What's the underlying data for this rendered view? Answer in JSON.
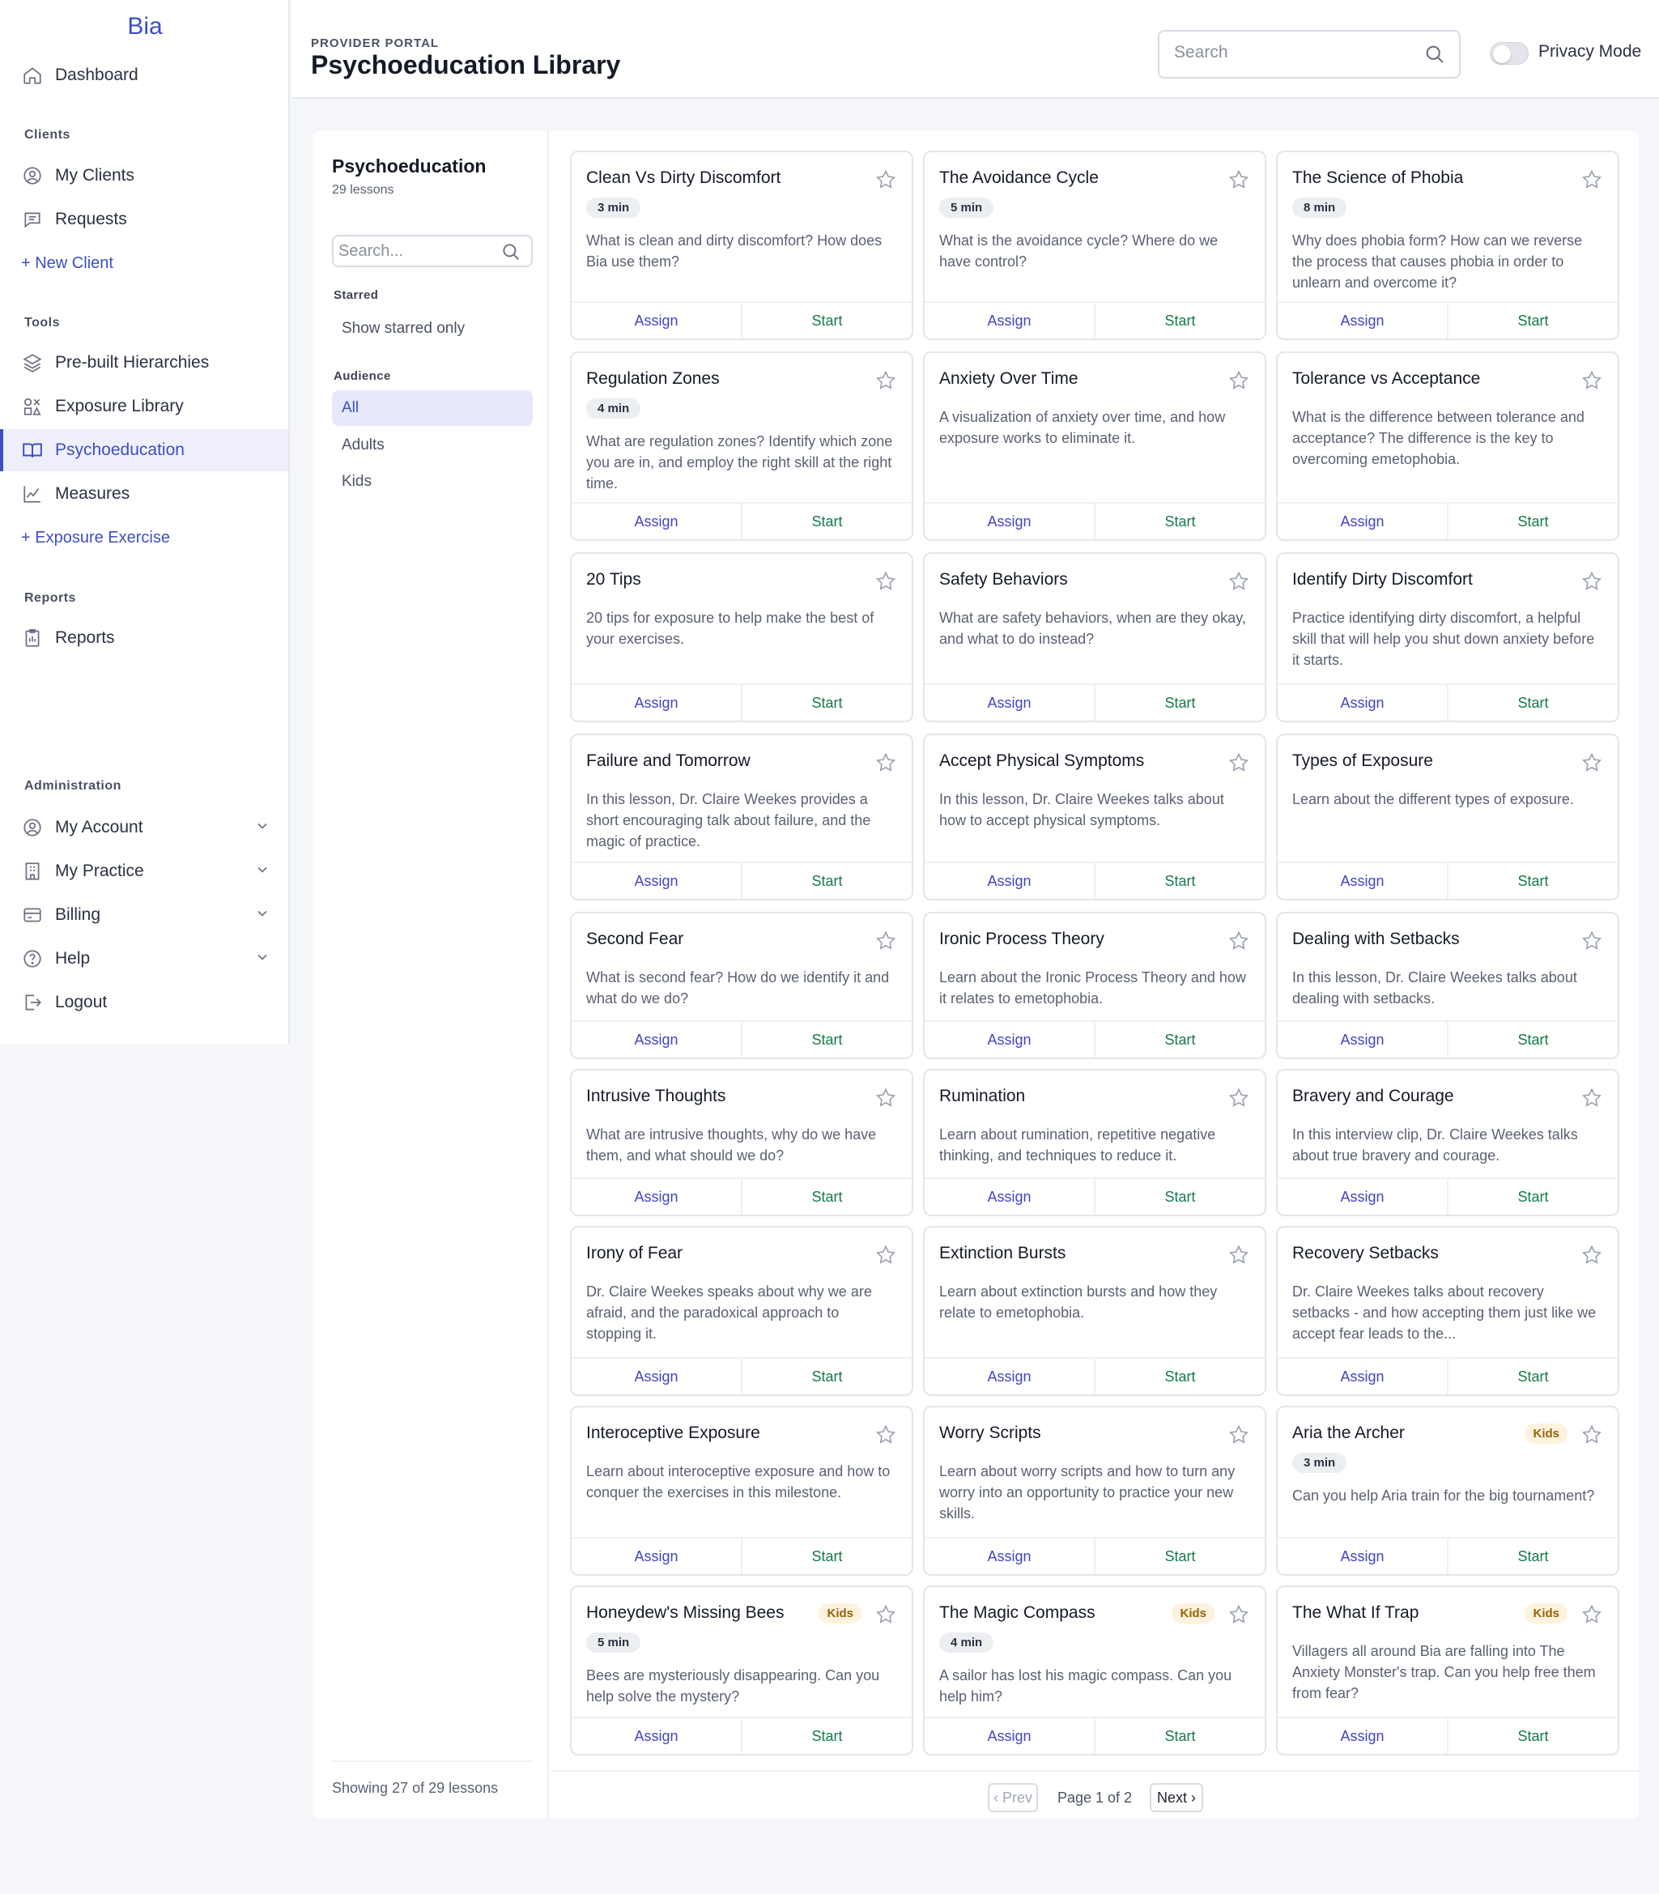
{
  "app": {
    "brand": "Bia"
  },
  "sidebar": {
    "dashboard": "Dashboard",
    "clients_label": "Clients",
    "my_clients": "My Clients",
    "requests": "Requests",
    "new_client": "+ New Client",
    "tools_label": "Tools",
    "prebuilt": "Pre-built Hierarchies",
    "exposure_library": "Exposure Library",
    "psychoeducation": "Psychoeducation",
    "measures": "Measures",
    "exposure_exercise": "+ Exposure Exercise",
    "reports_label": "Reports",
    "reports": "Reports",
    "admin_label": "Administration",
    "my_account": "My Account",
    "my_practice": "My Practice",
    "billing": "Billing",
    "help": "Help",
    "logout": "Logout"
  },
  "header": {
    "crumb": "PROVIDER PORTAL",
    "title": "Psychoeducation Library",
    "search_placeholder": "Search",
    "privacy_label": "Privacy Mode",
    "privacy_on": false
  },
  "filter": {
    "title": "Psychoeducation",
    "subtitle": "29 lessons",
    "search_placeholder": "Search...",
    "starred_label": "Starred",
    "starred_option": "Show starred only",
    "audience_label": "Audience",
    "audience": [
      "All",
      "Adults",
      "Kids"
    ],
    "audience_selected": "All",
    "showing": "Showing 27 of 29 lessons"
  },
  "actions": {
    "assign": "Assign",
    "start": "Start"
  },
  "cards": [
    {
      "title": "Clean Vs Dirty Discomfort",
      "duration": "3 min",
      "desc": "What is clean and dirty discomfort? How does Bia use them?"
    },
    {
      "title": "The Avoidance Cycle",
      "duration": "5 min",
      "desc": "What is the avoidance cycle? Where do we have control?"
    },
    {
      "title": "The Science of Phobia",
      "duration": "8 min",
      "desc": "Why does phobia form? How can we reverse the process that causes phobia in order to unlearn and overcome it?"
    },
    {
      "title": "Regulation Zones",
      "duration": "4 min",
      "desc": "What are regulation zones? Identify which zone you are in, and employ the right skill at the right time."
    },
    {
      "title": "Anxiety Over Time",
      "desc": "A visualization of anxiety over time, and how exposure works to eliminate it."
    },
    {
      "title": "Tolerance vs Acceptance",
      "desc": "What is the difference between tolerance and acceptance? The difference is the key to overcoming emetophobia."
    },
    {
      "title": "20 Tips",
      "desc": "20 tips for exposure to help make the best of your exercises."
    },
    {
      "title": "Safety Behaviors",
      "desc": "What are safety behaviors, when are they okay, and what to do instead?"
    },
    {
      "title": "Identify Dirty Discomfort",
      "desc": "Practice identifying dirty discomfort, a helpful skill that will help you shut down anxiety before it starts."
    },
    {
      "title": "Failure and Tomorrow",
      "desc": "In this lesson, Dr. Claire Weekes provides a short encouraging talk about failure, and the magic of practice."
    },
    {
      "title": "Accept Physical Symptoms",
      "desc": "In this lesson, Dr. Claire Weekes talks about how to accept physical symptoms."
    },
    {
      "title": "Types of Exposure",
      "desc": "Learn about the different types of exposure."
    },
    {
      "title": "Second Fear",
      "desc": "What is second fear? How do we identify it and what do we do?"
    },
    {
      "title": "Ironic Process Theory",
      "desc": "Learn about the Ironic Process Theory and how it relates to emetophobia."
    },
    {
      "title": "Dealing with Setbacks",
      "desc": "In this lesson, Dr. Claire Weekes talks about dealing with setbacks."
    },
    {
      "title": "Intrusive Thoughts",
      "desc": "What are intrusive thoughts, why do we have them, and what should we do?"
    },
    {
      "title": "Rumination",
      "desc": "Learn about rumination, repetitive negative thinking, and techniques to reduce it."
    },
    {
      "title": "Bravery and Courage",
      "desc": "In this interview clip, Dr. Claire Weekes talks about true bravery and courage."
    },
    {
      "title": "Irony of Fear",
      "desc": "Dr. Claire Weekes speaks about why we are afraid, and the paradoxical approach to stopping it."
    },
    {
      "title": "Extinction Bursts",
      "desc": "Learn about extinction bursts and how they relate to emetophobia."
    },
    {
      "title": "Recovery Setbacks",
      "desc": "Dr. Claire Weekes talks about recovery setbacks - and how accepting them just like we accept fear leads to the..."
    },
    {
      "title": "Interoceptive Exposure",
      "desc": "Learn about interoceptive exposure and how to conquer the exercises in this milestone."
    },
    {
      "title": "Worry Scripts",
      "desc": "Learn about worry scripts and how to turn any worry into an opportunity to practice your new skills."
    },
    {
      "title": "Aria the Archer",
      "badge": "Kids",
      "duration": "3 min",
      "desc": "Can you help Aria train for the big tournament?"
    },
    {
      "title": "Honeydew's Missing Bees",
      "badge": "Kids",
      "duration": "5 min",
      "desc": "Bees are mysteriously disappearing. Can you help solve the mystery?"
    },
    {
      "title": "The Magic Compass",
      "badge": "Kids",
      "duration": "4 min",
      "desc": "A sailor has lost his magic compass. Can you help him?"
    },
    {
      "title": "The What If Trap",
      "badge": "Kids",
      "desc": "Villagers all around Bia are falling into The Anxiety Monster's trap. Can you help free them from fear?"
    }
  ],
  "pagination": {
    "prev": "‹ Prev",
    "page_text": "Page 1 of 2",
    "next": "Next ›"
  }
}
